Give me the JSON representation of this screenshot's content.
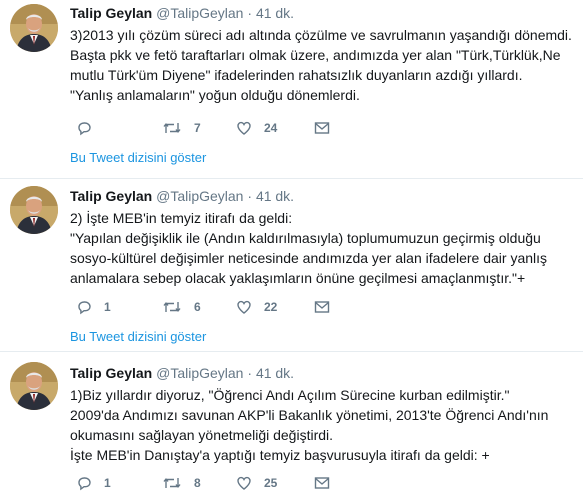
{
  "tweets": [
    {
      "name": "Talip Geylan",
      "handle": "@TalipGeylan",
      "dot": "·",
      "time": "41 dk.",
      "lines": [
        "3)2013 yılı çözüm süreci adı altında çözülme ve savrulmanın yaşandığı dönemdi.",
        "Başta pkk ve fetö taraftarları olmak üzere, andımızda yer alan \"Türk,Türklük,Ne",
        "mutlu Türk'üm Diyene\" ifadelerinden rahatsızlık duyanların azdığı yıllardı.",
        "\"Yanlış anlamaların\" yoğun olduğu dönemlerdi."
      ],
      "reply_count": "",
      "retweet_count": "7",
      "like_count": "24",
      "thread_link": "Bu Tweet dizisini göster"
    },
    {
      "name": "Talip Geylan",
      "handle": "@TalipGeylan",
      "dot": "·",
      "time": "41 dk.",
      "lines": [
        "2) İşte MEB'in temyiz itirafı da geldi:",
        "\"Yapılan değişiklik ile (Andın kaldırılmasıyla) toplumumuzun geçirmiş olduğu",
        "sosyo-kültürel değişimler neticesinde andımızda yer alan ifadelere dair yanlış",
        "anlamalara sebep olacak yaklaşımların önüne geçilmesi amaçlanmıştır.\"+"
      ],
      "reply_count": "1",
      "retweet_count": "6",
      "like_count": "22",
      "thread_link": "Bu Tweet dizisini göster"
    },
    {
      "name": "Talip Geylan",
      "handle": "@TalipGeylan",
      "dot": "·",
      "time": "41 dk.",
      "lines": [
        "1)Biz yıllardır diyoruz, \"Öğrenci Andı Açılım Sürecine kurban edilmiştir.\"",
        "2009'da Andımızı savunan AKP'li Bakanlık yönetimi, 2013'te Öğrenci Andı'nın",
        "okumasını sağlayan yönetmeliği değiştirdi.",
        "İşte MEB'in Danıştay'a yaptığı temyiz başvurusuyla itirafı da geldi: +"
      ],
      "reply_count": "1",
      "retweet_count": "8",
      "like_count": "25",
      "thread_link": ""
    }
  ],
  "colors": {
    "text": "#14171a",
    "secondary": "#657786",
    "link": "#1b95e0",
    "divider": "#e6ecf0"
  }
}
